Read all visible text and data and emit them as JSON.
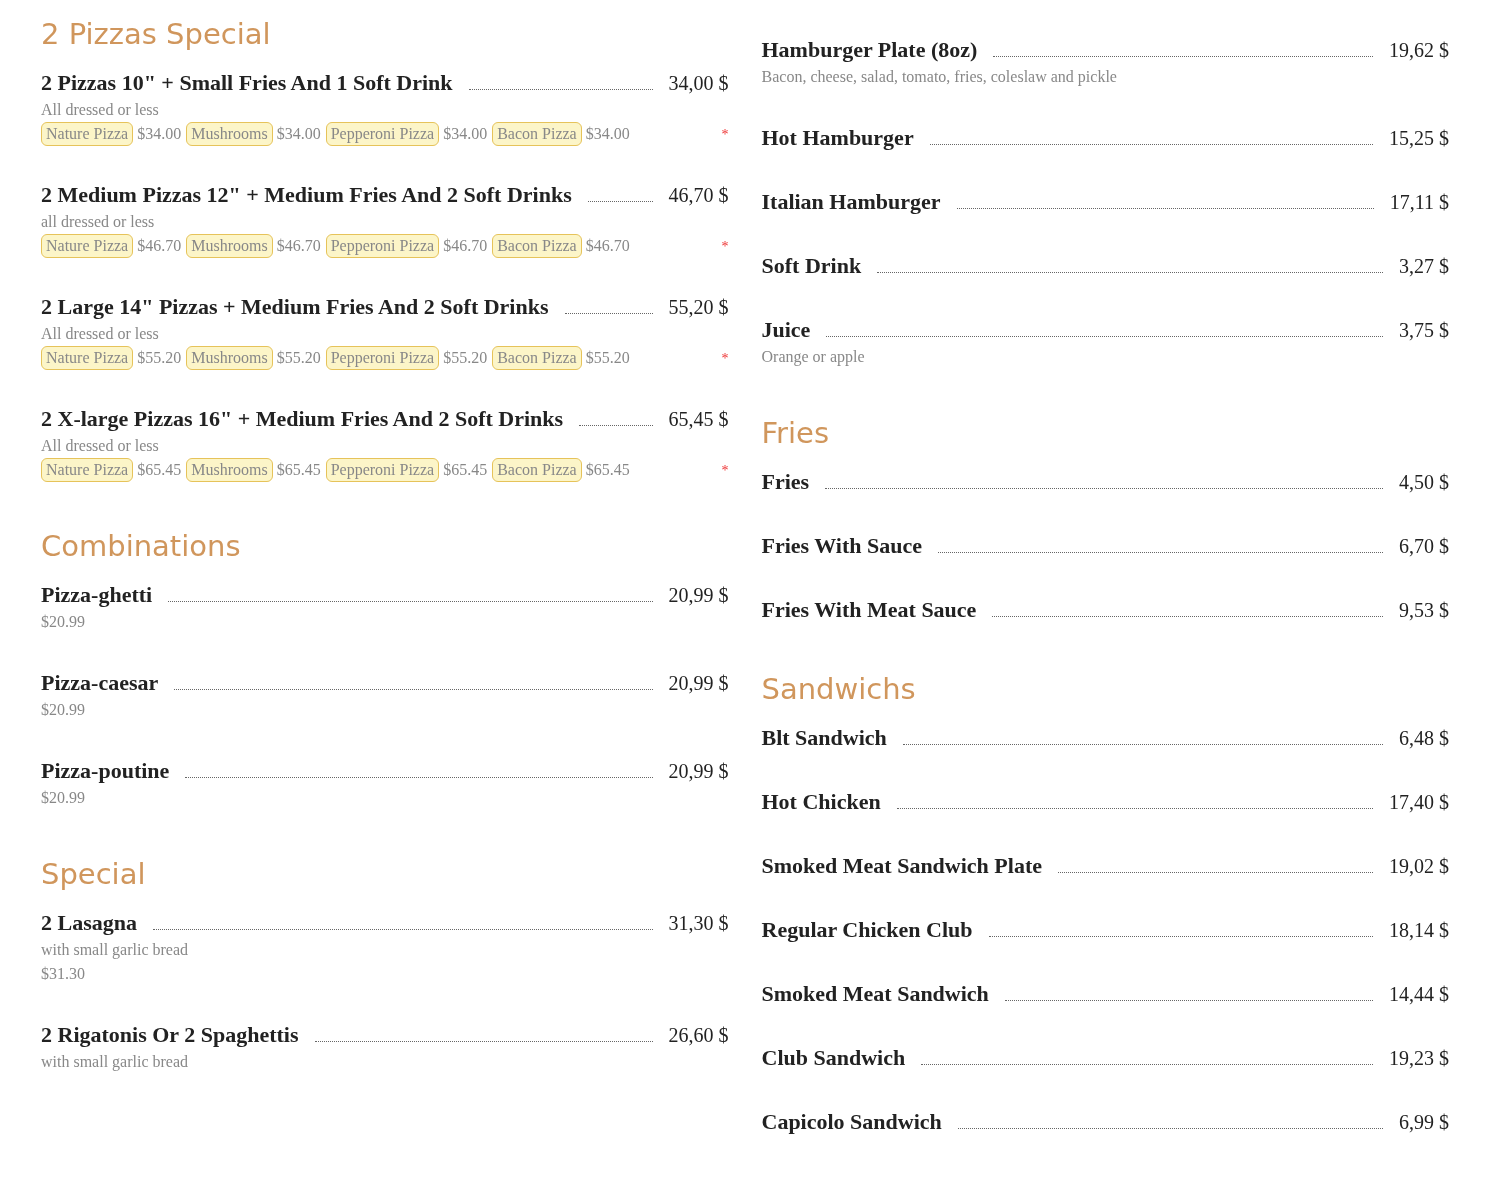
{
  "columns": [
    {
      "sections": [
        {
          "title": "2 Pizzas Special",
          "items": [
            {
              "name": "2 Pizzas 10\" + Small Fries And 1 Soft Drink",
              "price": "34,00 $",
              "lines": [
                "All dressed or less"
              ],
              "options": [
                {
                  "label": "Nature Pizza",
                  "price": "$34.00"
                },
                {
                  "label": "Mushrooms",
                  "price": "$34.00"
                },
                {
                  "label": "Pepperoni Pizza",
                  "price": "$34.00"
                },
                {
                  "label": "Bacon Pizza",
                  "price": "$34.00"
                }
              ],
              "mark": "*"
            },
            {
              "name": "2 Medium Pizzas 12\" + Medium Fries And 2 Soft Drinks",
              "price": "46,70 $",
              "lines": [
                "all dressed or less"
              ],
              "options": [
                {
                  "label": "Nature Pizza",
                  "price": "$46.70"
                },
                {
                  "label": "Mushrooms",
                  "price": "$46.70"
                },
                {
                  "label": "Pepperoni Pizza",
                  "price": "$46.70"
                },
                {
                  "label": "Bacon Pizza",
                  "price": "$46.70"
                }
              ],
              "mark": "*"
            },
            {
              "name": "2 Large 14\" Pizzas + Medium Fries And 2 Soft Drinks",
              "price": "55,20 $",
              "lines": [
                "All dressed or less"
              ],
              "options": [
                {
                  "label": "Nature Pizza",
                  "price": "$55.20"
                },
                {
                  "label": "Mushrooms",
                  "price": "$55.20"
                },
                {
                  "label": "Pepperoni Pizza",
                  "price": "$55.20"
                },
                {
                  "label": "Bacon Pizza",
                  "price": "$55.20"
                }
              ],
              "mark": "*"
            },
            {
              "name": "2 X-large Pizzas 16\" + Medium Fries And 2 Soft Drinks",
              "price": "65,45 $",
              "lines": [
                "All dressed or less"
              ],
              "options": [
                {
                  "label": "Nature Pizza",
                  "price": "$65.45"
                },
                {
                  "label": "Mushrooms",
                  "price": "$65.45"
                },
                {
                  "label": "Pepperoni Pizza",
                  "price": "$65.45"
                },
                {
                  "label": "Bacon Pizza",
                  "price": "$65.45"
                }
              ],
              "mark": "*"
            }
          ]
        },
        {
          "title": "Combinations",
          "items": [
            {
              "name": "Pizza-ghetti",
              "price": "20,99 $",
              "lines": [
                "$20.99"
              ]
            },
            {
              "name": "Pizza-caesar",
              "price": "20,99 $",
              "lines": [
                "$20.99"
              ]
            },
            {
              "name": "Pizza-poutine",
              "price": "20,99 $",
              "lines": [
                "$20.99"
              ]
            }
          ]
        },
        {
          "title": "Special",
          "items": [
            {
              "name": "2 Lasagna",
              "price": "31,30 $",
              "lines": [
                "with small garlic bread",
                "$31.30"
              ]
            },
            {
              "name": "2 Rigatonis Or 2 Spaghettis",
              "price": "26,60 $",
              "lines": [
                "with small garlic bread"
              ]
            }
          ]
        }
      ]
    },
    {
      "sections": [
        {
          "items": [
            {
              "name": "Hamburger Plate (8oz)",
              "price": "19,62 $",
              "lines": [
                "Bacon, cheese, salad, tomato, fries, coleslaw and pickle"
              ]
            },
            {
              "name": "Hot Hamburger",
              "price": "15,25 $"
            },
            {
              "name": "Italian Hamburger",
              "price": "17,11 $"
            },
            {
              "name": "Soft Drink",
              "price": "3,27 $"
            },
            {
              "name": "Juice",
              "price": "3,75 $",
              "lines": [
                "Orange or apple"
              ]
            }
          ]
        },
        {
          "title": "Fries",
          "items": [
            {
              "name": "Fries",
              "price": "4,50 $"
            },
            {
              "name": "Fries With Sauce",
              "price": "6,70 $"
            },
            {
              "name": "Fries With Meat Sauce",
              "price": "9,53 $"
            }
          ]
        },
        {
          "title": "Sandwichs",
          "items": [
            {
              "name": "Blt Sandwich",
              "price": "6,48 $"
            },
            {
              "name": "Hot Chicken",
              "price": "17,40 $"
            },
            {
              "name": "Smoked Meat Sandwich Plate",
              "price": "19,02 $"
            },
            {
              "name": "Regular Chicken Club",
              "price": "18,14 $"
            },
            {
              "name": "Smoked Meat Sandwich",
              "price": "14,44 $"
            },
            {
              "name": "Club Sandwich",
              "price": "19,23 $"
            },
            {
              "name": "Capicolo Sandwich",
              "price": "6,99 $"
            }
          ]
        }
      ]
    }
  ]
}
